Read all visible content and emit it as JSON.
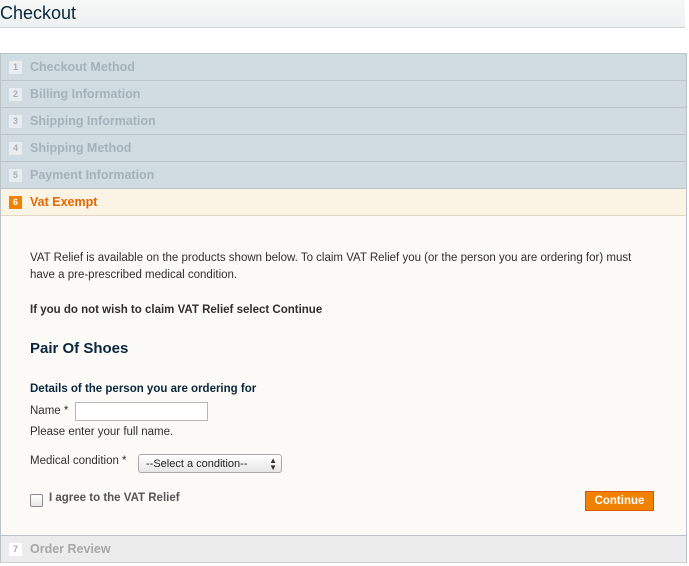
{
  "page": {
    "title": "Checkout"
  },
  "steps": [
    {
      "num": "1",
      "label": "Checkout Method"
    },
    {
      "num": "2",
      "label": "Billing Information"
    },
    {
      "num": "3",
      "label": "Shipping Information"
    },
    {
      "num": "4",
      "label": "Shipping Method"
    },
    {
      "num": "5",
      "label": "Payment Information"
    },
    {
      "num": "6",
      "label": "Vat Exempt"
    },
    {
      "num": "7",
      "label": "Order Review"
    }
  ],
  "vat": {
    "intro": "VAT Relief is available on the products shown below. To claim VAT Relief you (or the person you are ordering for) must have a pre-prescribed medical condition.",
    "notice": "If you do not wish to claim VAT Relief select Continue",
    "product": "Pair Of Shoes",
    "details_heading": "Details of the person you are ordering for",
    "name_label": "Name *",
    "name_value": "",
    "name_hint": "Please enter your full name.",
    "condition_label": "Medical condition *",
    "condition_selected": "--Select a condition--",
    "agree_label": "I agree to the VAT Relief",
    "agree_checked": false,
    "continue_label": "Continue"
  },
  "colors": {
    "accent": "#f18200",
    "step_bg": "#d0dce2",
    "active_bg": "#fbf3e4",
    "heading": "#0a263c"
  }
}
